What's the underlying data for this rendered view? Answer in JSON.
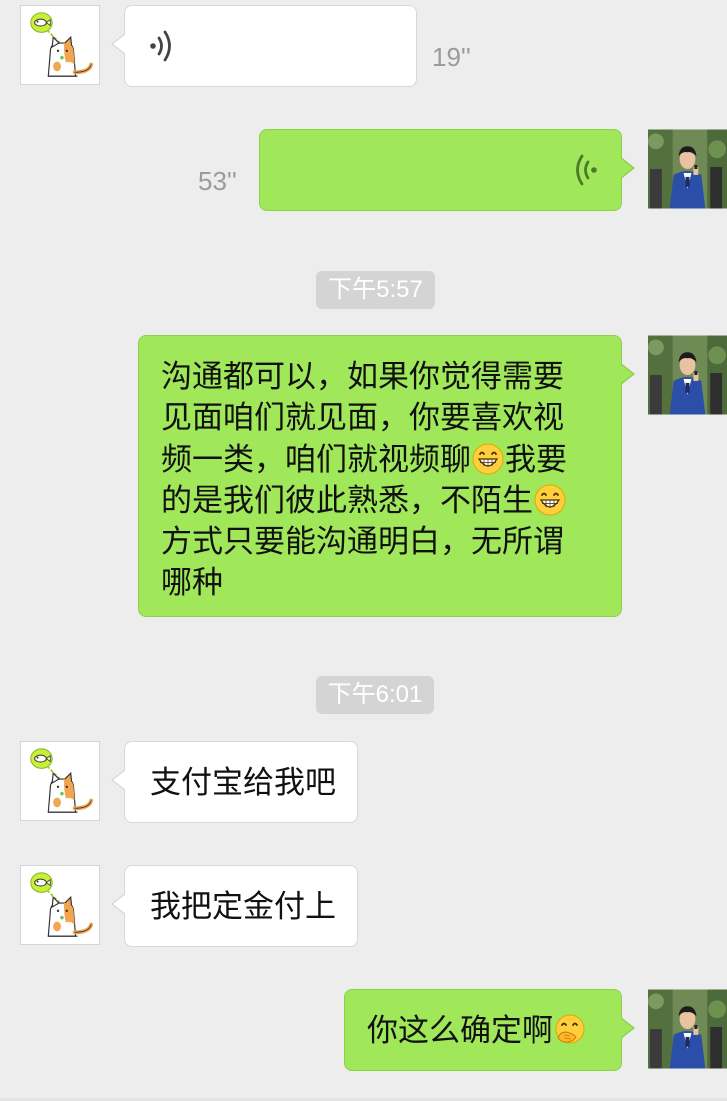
{
  "conversation": {
    "messages": [
      {
        "type": "voice",
        "side": "left",
        "duration": "19''"
      },
      {
        "type": "voice",
        "side": "right",
        "duration": "53''"
      },
      {
        "type": "time",
        "text": "下午5:57"
      },
      {
        "type": "text",
        "side": "right",
        "lines": [
          "沟通都可以，如果你觉得需要",
          "见面咱们就见面，你要喜欢视",
          "频一类，咱们就视频聊",
          "我要",
          "的是我们彼此熟悉，不陌生",
          "方式只要能沟通明白，无所谓",
          "哪种"
        ]
      },
      {
        "type": "time",
        "text": "下午6:01"
      },
      {
        "type": "text",
        "side": "left",
        "text": "支付宝给我吧"
      },
      {
        "type": "text",
        "side": "left",
        "text": "我把定金付上"
      },
      {
        "type": "text",
        "side": "right",
        "text": "你这么确定啊"
      }
    ]
  },
  "icons": {
    "voice_left": "voice-wave-icon",
    "voice_right": "voice-wave-icon",
    "emoji_grin": "grinning-face-emoji",
    "emoji_thinking": "face-with-hand-over-mouth-emoji"
  },
  "colors": {
    "background": "#ededed",
    "incoming_bubble": "#ffffff",
    "outgoing_bubble": "#a0e75a",
    "timestamp_bg": "#d4d4d4"
  }
}
